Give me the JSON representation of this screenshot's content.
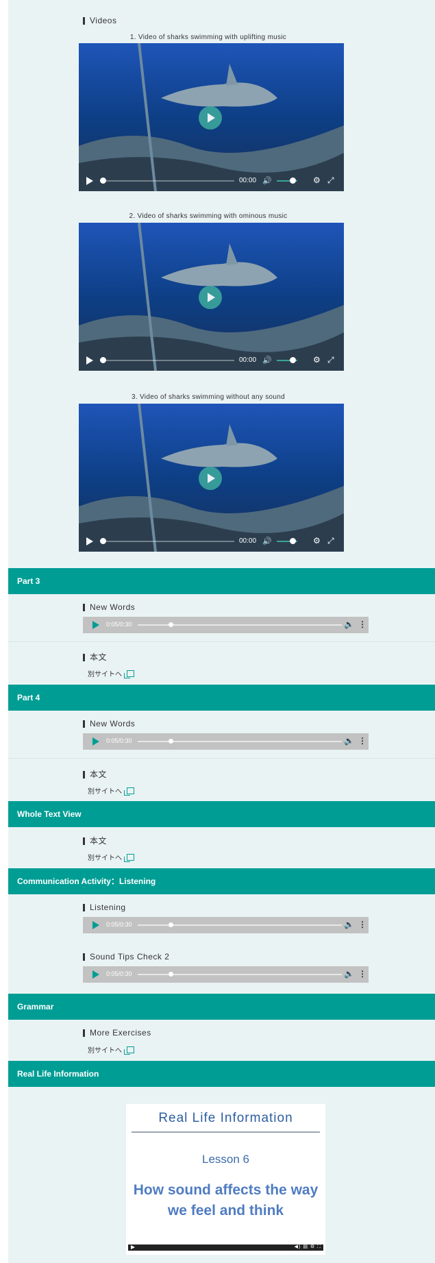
{
  "videos_section": {
    "title": "Videos",
    "videos": [
      {
        "caption": "1. Video of sharks swimming with uplifting music",
        "time": "00:00"
      },
      {
        "caption": "2. Video of sharks swimming with ominous music",
        "time": "00:00"
      },
      {
        "caption": "3. Video of sharks swimming without any sound",
        "time": "00:00"
      }
    ]
  },
  "parts": [
    {
      "title": "Part 3",
      "new_words_label": "New Words",
      "audio_time": "0:05/0:30",
      "honbun_label": "本文",
      "link_text": "別サイトへ"
    },
    {
      "title": "Part 4",
      "new_words_label": "New Words",
      "audio_time": "0:05/0:30",
      "honbun_label": "本文",
      "link_text": "別サイトへ"
    }
  ],
  "whole_text": {
    "title": "Whole Text View",
    "honbun_label": "本文",
    "link_text": "別サイトへ"
  },
  "communication": {
    "title": "Communication Activity：Listening",
    "listening_label": "Listening",
    "listening_time": "0:05/0:30",
    "sound_tips_label": "Sound Tips  Check 2",
    "sound_tips_time": "0:05/0:30"
  },
  "grammar": {
    "title": "Grammar",
    "exercises_label": "More Exercises",
    "link_text": "別サイトへ"
  },
  "real_life": {
    "title": "Real Life Information",
    "card_title": "Real Life Information",
    "lesson": "Lesson 6",
    "headline": "How sound affects the way we feel and think"
  }
}
